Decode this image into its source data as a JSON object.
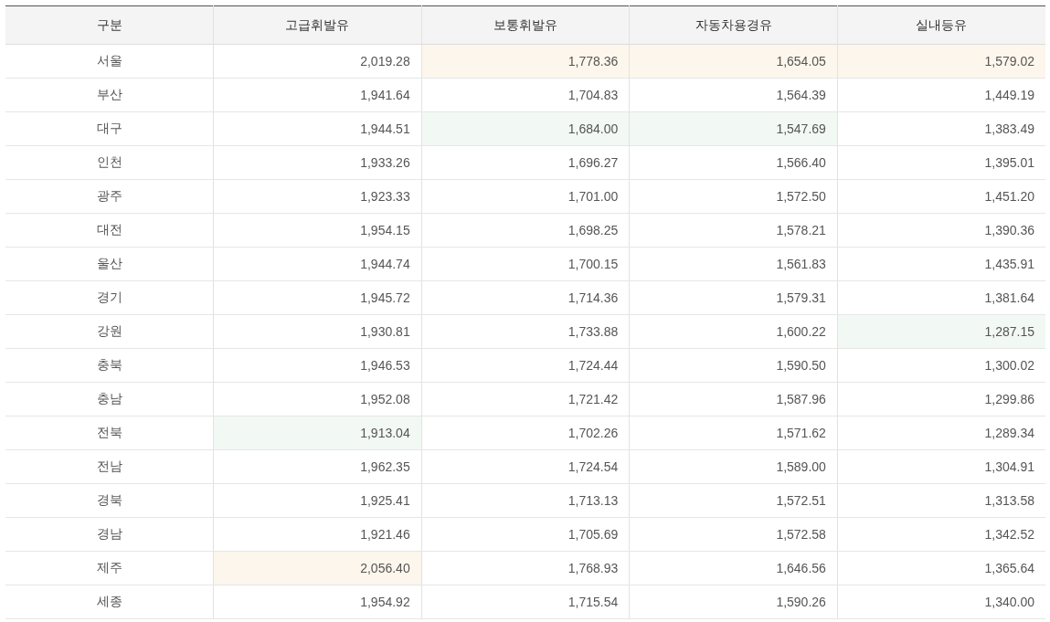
{
  "table": {
    "columns": [
      "구분",
      "고급휘발유",
      "보통휘발유",
      "자동차용경유",
      "실내등유"
    ],
    "rows": [
      {
        "cells": [
          {
            "value": "서울",
            "highest": false,
            "lowest": false
          },
          {
            "value": "2,019.28",
            "highest": false,
            "lowest": false
          },
          {
            "value": "1,778.36",
            "highest": true,
            "lowest": false
          },
          {
            "value": "1,654.05",
            "highest": true,
            "lowest": false
          },
          {
            "value": "1,579.02",
            "highest": true,
            "lowest": false
          }
        ]
      },
      {
        "cells": [
          {
            "value": "부산",
            "highest": false,
            "lowest": false
          },
          {
            "value": "1,941.64",
            "highest": false,
            "lowest": false
          },
          {
            "value": "1,704.83",
            "highest": false,
            "lowest": false
          },
          {
            "value": "1,564.39",
            "highest": false,
            "lowest": false
          },
          {
            "value": "1,449.19",
            "highest": false,
            "lowest": false
          }
        ]
      },
      {
        "cells": [
          {
            "value": "대구",
            "highest": false,
            "lowest": false
          },
          {
            "value": "1,944.51",
            "highest": false,
            "lowest": false
          },
          {
            "value": "1,684.00",
            "highest": false,
            "lowest": true
          },
          {
            "value": "1,547.69",
            "highest": false,
            "lowest": true
          },
          {
            "value": "1,383.49",
            "highest": false,
            "lowest": false
          }
        ]
      },
      {
        "cells": [
          {
            "value": "인천",
            "highest": false,
            "lowest": false
          },
          {
            "value": "1,933.26",
            "highest": false,
            "lowest": false
          },
          {
            "value": "1,696.27",
            "highest": false,
            "lowest": false
          },
          {
            "value": "1,566.40",
            "highest": false,
            "lowest": false
          },
          {
            "value": "1,395.01",
            "highest": false,
            "lowest": false
          }
        ]
      },
      {
        "cells": [
          {
            "value": "광주",
            "highest": false,
            "lowest": false
          },
          {
            "value": "1,923.33",
            "highest": false,
            "lowest": false
          },
          {
            "value": "1,701.00",
            "highest": false,
            "lowest": false
          },
          {
            "value": "1,572.50",
            "highest": false,
            "lowest": false
          },
          {
            "value": "1,451.20",
            "highest": false,
            "lowest": false
          }
        ]
      },
      {
        "cells": [
          {
            "value": "대전",
            "highest": false,
            "lowest": false
          },
          {
            "value": "1,954.15",
            "highest": false,
            "lowest": false
          },
          {
            "value": "1,698.25",
            "highest": false,
            "lowest": false
          },
          {
            "value": "1,578.21",
            "highest": false,
            "lowest": false
          },
          {
            "value": "1,390.36",
            "highest": false,
            "lowest": false
          }
        ]
      },
      {
        "cells": [
          {
            "value": "울산",
            "highest": false,
            "lowest": false
          },
          {
            "value": "1,944.74",
            "highest": false,
            "lowest": false
          },
          {
            "value": "1,700.15",
            "highest": false,
            "lowest": false
          },
          {
            "value": "1,561.83",
            "highest": false,
            "lowest": false
          },
          {
            "value": "1,435.91",
            "highest": false,
            "lowest": false
          }
        ]
      },
      {
        "cells": [
          {
            "value": "경기",
            "highest": false,
            "lowest": false
          },
          {
            "value": "1,945.72",
            "highest": false,
            "lowest": false
          },
          {
            "value": "1,714.36",
            "highest": false,
            "lowest": false
          },
          {
            "value": "1,579.31",
            "highest": false,
            "lowest": false
          },
          {
            "value": "1,381.64",
            "highest": false,
            "lowest": false
          }
        ]
      },
      {
        "cells": [
          {
            "value": "강원",
            "highest": false,
            "lowest": false
          },
          {
            "value": "1,930.81",
            "highest": false,
            "lowest": false
          },
          {
            "value": "1,733.88",
            "highest": false,
            "lowest": false
          },
          {
            "value": "1,600.22",
            "highest": false,
            "lowest": false
          },
          {
            "value": "1,287.15",
            "highest": false,
            "lowest": true
          }
        ]
      },
      {
        "cells": [
          {
            "value": "충북",
            "highest": false,
            "lowest": false
          },
          {
            "value": "1,946.53",
            "highest": false,
            "lowest": false
          },
          {
            "value": "1,724.44",
            "highest": false,
            "lowest": false
          },
          {
            "value": "1,590.50",
            "highest": false,
            "lowest": false
          },
          {
            "value": "1,300.02",
            "highest": false,
            "lowest": false
          }
        ]
      },
      {
        "cells": [
          {
            "value": "충남",
            "highest": false,
            "lowest": false
          },
          {
            "value": "1,952.08",
            "highest": false,
            "lowest": false
          },
          {
            "value": "1,721.42",
            "highest": false,
            "lowest": false
          },
          {
            "value": "1,587.96",
            "highest": false,
            "lowest": false
          },
          {
            "value": "1,299.86",
            "highest": false,
            "lowest": false
          }
        ]
      },
      {
        "cells": [
          {
            "value": "전북",
            "highest": false,
            "lowest": false
          },
          {
            "value": "1,913.04",
            "highest": false,
            "lowest": true
          },
          {
            "value": "1,702.26",
            "highest": false,
            "lowest": false
          },
          {
            "value": "1,571.62",
            "highest": false,
            "lowest": false
          },
          {
            "value": "1,289.34",
            "highest": false,
            "lowest": false
          }
        ]
      },
      {
        "cells": [
          {
            "value": "전남",
            "highest": false,
            "lowest": false
          },
          {
            "value": "1,962.35",
            "highest": false,
            "lowest": false
          },
          {
            "value": "1,724.54",
            "highest": false,
            "lowest": false
          },
          {
            "value": "1,589.00",
            "highest": false,
            "lowest": false
          },
          {
            "value": "1,304.91",
            "highest": false,
            "lowest": false
          }
        ]
      },
      {
        "cells": [
          {
            "value": "경북",
            "highest": false,
            "lowest": false
          },
          {
            "value": "1,925.41",
            "highest": false,
            "lowest": false
          },
          {
            "value": "1,713.13",
            "highest": false,
            "lowest": false
          },
          {
            "value": "1,572.51",
            "highest": false,
            "lowest": false
          },
          {
            "value": "1,313.58",
            "highest": false,
            "lowest": false
          }
        ]
      },
      {
        "cells": [
          {
            "value": "경남",
            "highest": false,
            "lowest": false
          },
          {
            "value": "1,921.46",
            "highest": false,
            "lowest": false
          },
          {
            "value": "1,705.69",
            "highest": false,
            "lowest": false
          },
          {
            "value": "1,572.58",
            "highest": false,
            "lowest": false
          },
          {
            "value": "1,342.52",
            "highest": false,
            "lowest": false
          }
        ]
      },
      {
        "cells": [
          {
            "value": "제주",
            "highest": false,
            "lowest": false
          },
          {
            "value": "2,056.40",
            "highest": true,
            "lowest": false
          },
          {
            "value": "1,768.93",
            "highest": false,
            "lowest": false
          },
          {
            "value": "1,646.56",
            "highest": false,
            "lowest": false
          },
          {
            "value": "1,365.64",
            "highest": false,
            "lowest": false
          }
        ]
      },
      {
        "cells": [
          {
            "value": "세종",
            "highest": false,
            "lowest": false
          },
          {
            "value": "1,954.92",
            "highest": false,
            "lowest": false
          },
          {
            "value": "1,715.54",
            "highest": false,
            "lowest": false
          },
          {
            "value": "1,590.26",
            "highest": false,
            "lowest": false
          },
          {
            "value": "1,340.00",
            "highest": false,
            "lowest": false
          }
        ]
      }
    ]
  }
}
